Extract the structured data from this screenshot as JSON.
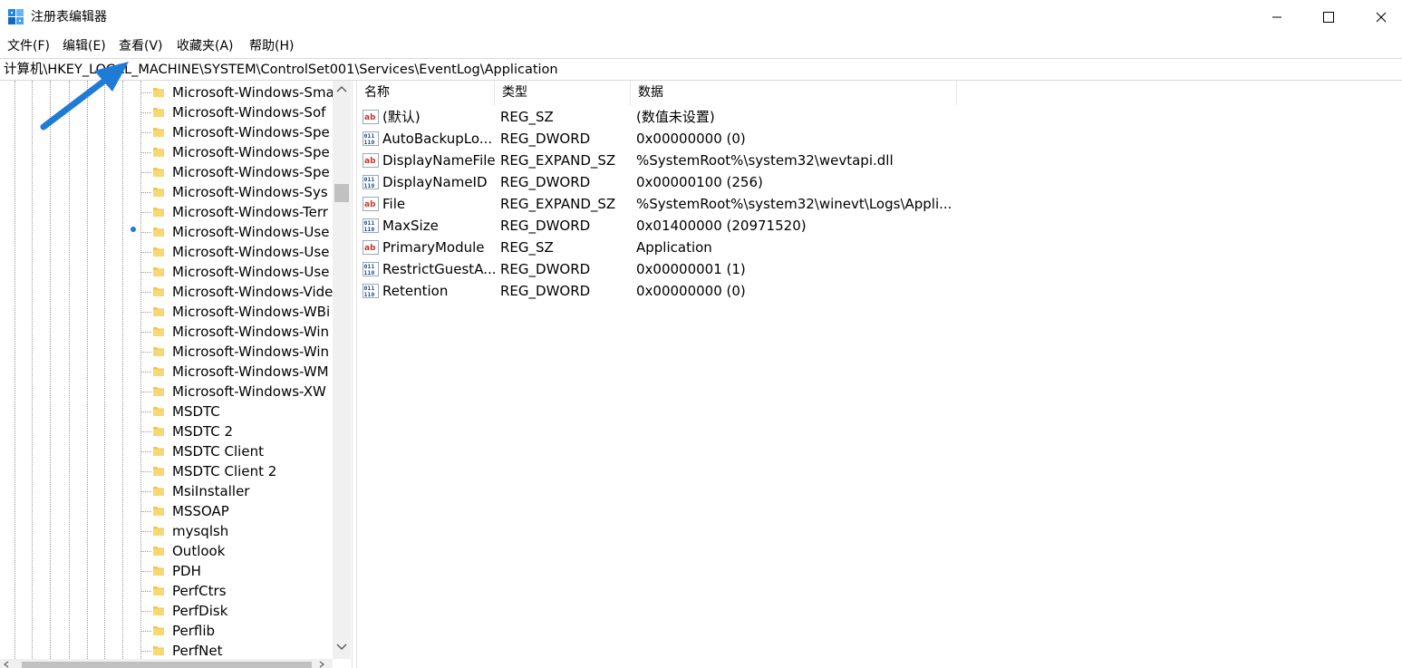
{
  "window": {
    "title": "注册表编辑器"
  },
  "menu": [
    "文件(F)",
    "编辑(E)",
    "查看(V)",
    "收藏夹(A)",
    "帮助(H)"
  ],
  "address": "计算机\\HKEY_LOCAL_MACHINE\\SYSTEM\\ControlSet001\\Services\\EventLog\\Application",
  "tree": {
    "items": [
      "Microsoft-Windows-Sma",
      "Microsoft-Windows-Sof",
      "Microsoft-Windows-Spe",
      "Microsoft-Windows-Spe",
      "Microsoft-Windows-Spe",
      "Microsoft-Windows-Sys",
      "Microsoft-Windows-Terr",
      "Microsoft-Windows-Use",
      "Microsoft-Windows-Use",
      "Microsoft-Windows-Use",
      "Microsoft-Windows-Vide",
      "Microsoft-Windows-WBi",
      "Microsoft-Windows-Win",
      "Microsoft-Windows-Win",
      "Microsoft-Windows-WM",
      "Microsoft-Windows-XW",
      "MSDTC",
      "MSDTC 2",
      "MSDTC Client",
      "MSDTC Client 2",
      "MsiInstaller",
      "MSSOAP",
      "mysqlsh",
      "Outlook",
      "PDH",
      "PerfCtrs",
      "PerfDisk",
      "Perflib",
      "PerfNet"
    ]
  },
  "columns": {
    "name": "名称",
    "type": "类型",
    "data": "数据"
  },
  "values": [
    {
      "icon": "string-value-icon",
      "name": "(默认)",
      "type": "REG_SZ",
      "data": "(数值未设置)"
    },
    {
      "icon": "binary-value-icon",
      "name": "AutoBackupLo...",
      "type": "REG_DWORD",
      "data": "0x00000000 (0)"
    },
    {
      "icon": "string-value-icon",
      "name": "DisplayNameFile",
      "type": "REG_EXPAND_SZ",
      "data": "%SystemRoot%\\system32\\wevtapi.dll"
    },
    {
      "icon": "binary-value-icon",
      "name": "DisplayNameID",
      "type": "REG_DWORD",
      "data": "0x00000100 (256)"
    },
    {
      "icon": "string-value-icon",
      "name": "File",
      "type": "REG_EXPAND_SZ",
      "data": "%SystemRoot%\\system32\\winevt\\Logs\\Appli..."
    },
    {
      "icon": "binary-value-icon",
      "name": "MaxSize",
      "type": "REG_DWORD",
      "data": "0x01400000 (20971520)"
    },
    {
      "icon": "string-value-icon",
      "name": "PrimaryModule",
      "type": "REG_SZ",
      "data": "Application"
    },
    {
      "icon": "binary-value-icon",
      "name": "RestrictGuestA...",
      "type": "REG_DWORD",
      "data": "0x00000001 (1)"
    },
    {
      "icon": "binary-value-icon",
      "name": "Retention",
      "type": "REG_DWORD",
      "data": "0x00000000 (0)"
    }
  ],
  "colors": {
    "folder": "#f3c440",
    "annotation_arrow": "#1e7bd6",
    "string_icon": "#c0392b",
    "binary_icon": "#1f4e8c"
  }
}
